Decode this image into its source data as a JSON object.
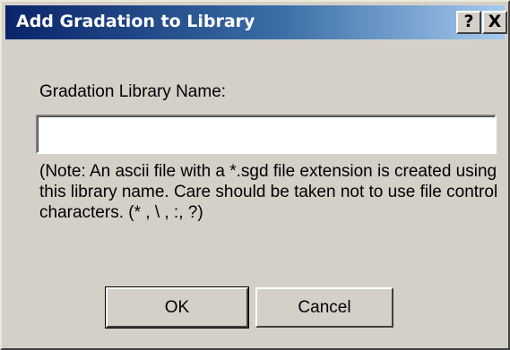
{
  "window": {
    "title": "Add Gradation to Library",
    "help_glyph": "?",
    "close_glyph": "X"
  },
  "form": {
    "name_label": "Gradation Library Name:",
    "name_value": "",
    "name_placeholder": "",
    "note": "(Note: An ascii file with a *.sgd file extension is created using this library name.  Care should be taken not to use file control characters. (* , \\ , :, ?)"
  },
  "buttons": {
    "ok_label": "OK",
    "cancel_label": "Cancel"
  }
}
